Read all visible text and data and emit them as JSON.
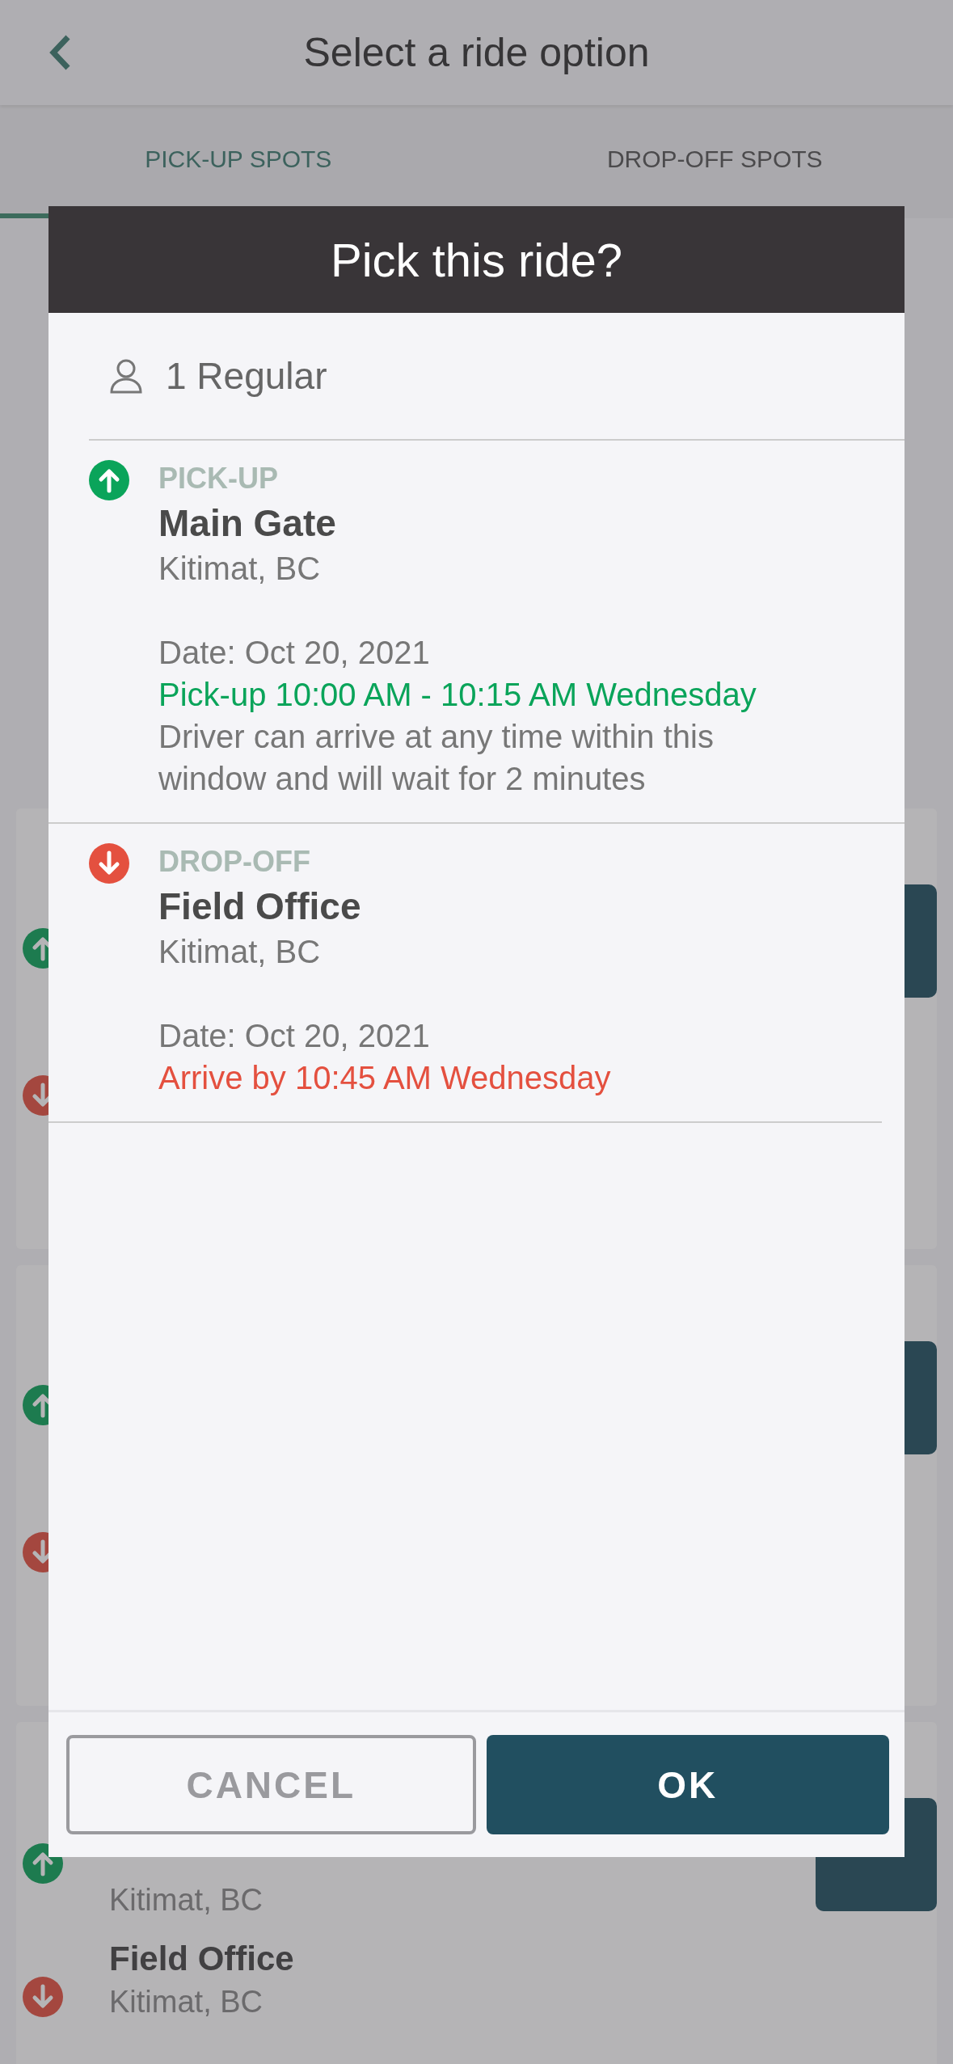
{
  "header": {
    "title": "Select a ride option"
  },
  "tabs": [
    {
      "label": "PICK-UP SPOTS",
      "selected": true
    },
    {
      "label": "DROP-OFF SPOTS",
      "selected": false
    }
  ],
  "background_card": {
    "stops": [
      {
        "kind": "pickup",
        "city": "Kitimat, BC"
      },
      {
        "kind": "dropoff",
        "name": "Field Office",
        "city": "Kitimat, BC"
      }
    ]
  },
  "dialog": {
    "title": "Pick this ride?",
    "passengers": "1 Regular",
    "stops": [
      {
        "kind": "pickup",
        "label": "PICK-UP",
        "name": "Main Gate",
        "city": "Kitimat, BC",
        "date": "Date: Oct 20, 2021",
        "time": "Pick-up 10:00 AM - 10:15 AM Wednesday",
        "note": "Driver can arrive at any time within this window and will wait for 2 minutes"
      },
      {
        "kind": "dropoff",
        "label": "DROP-OFF",
        "name": "Field Office",
        "city": "Kitimat, BC",
        "date": "Date: Oct 20, 2021",
        "time": "Arrive by 10:45 AM Wednesday"
      }
    ],
    "buttons": [
      {
        "label": "CANCEL",
        "kind": "secondary"
      },
      {
        "label": "OK",
        "kind": "primary"
      }
    ]
  }
}
